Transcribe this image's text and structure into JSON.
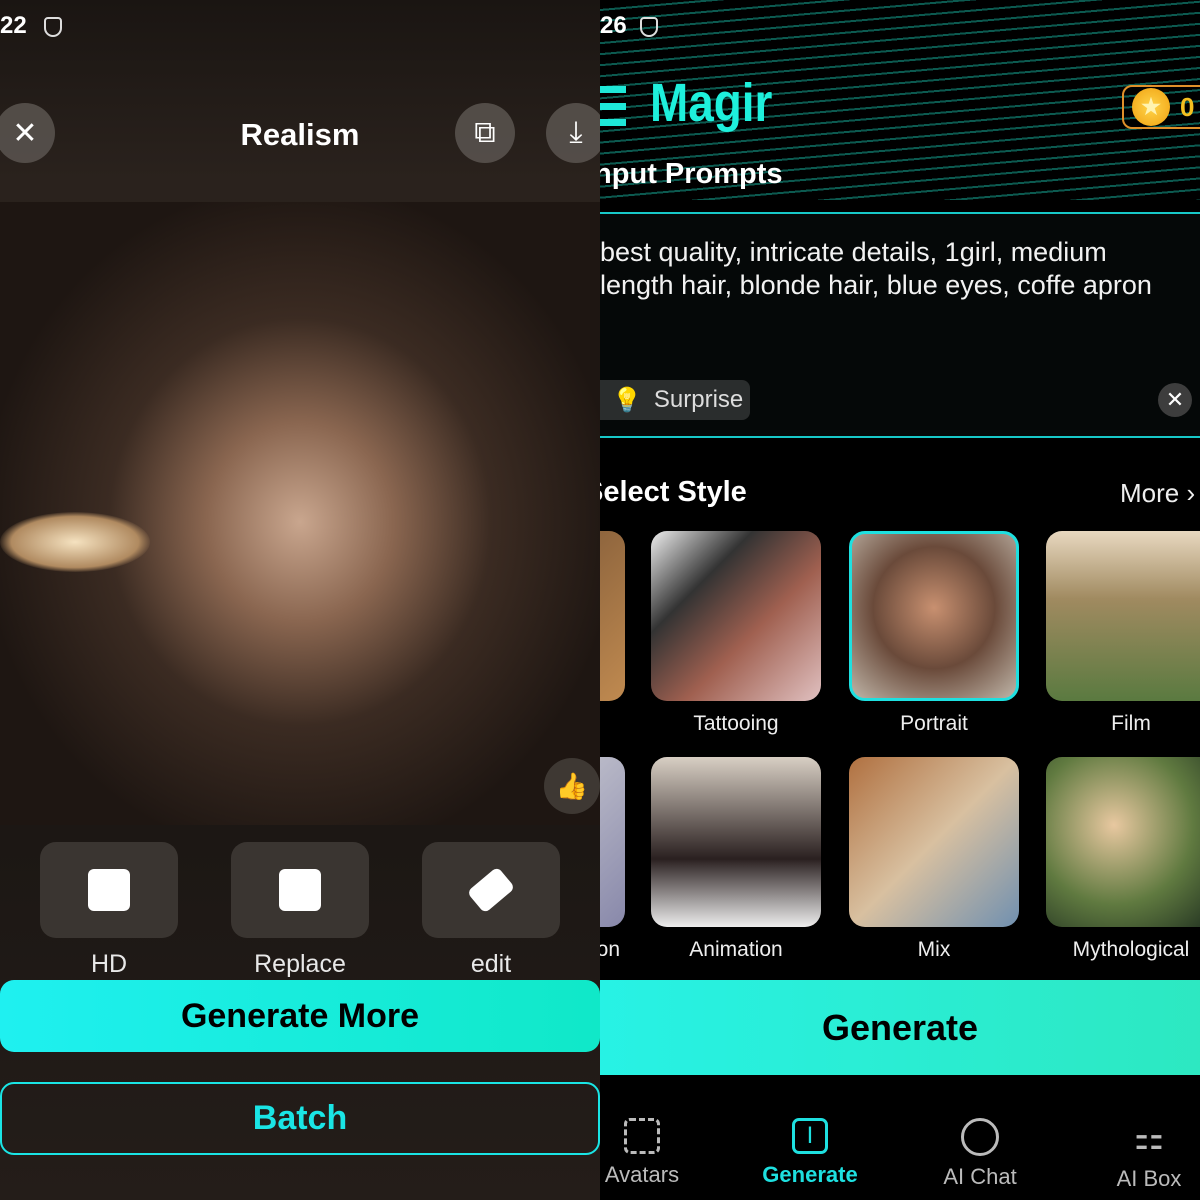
{
  "left": {
    "status_time": "22",
    "title": "Realism",
    "tools": [
      {
        "label": "HD",
        "icon": "expand-icon"
      },
      {
        "label": "Replace",
        "icon": "replace-image-icon"
      },
      {
        "label": "edit",
        "icon": "eraser-icon"
      }
    ],
    "generate_more": "Generate More",
    "batch": "Batch"
  },
  "right": {
    "status_time": "26",
    "app_name": "Magir",
    "coins": "0",
    "input_prompts_title": "Input Prompts",
    "prompt_text": "best quality, intricate details, 1girl,  medium length hair, blonde hair, blue eyes, coffe apron",
    "surprise": "Surprise",
    "select_style_title": "Select Style",
    "more": "More",
    "styles": [
      {
        "label": ""
      },
      {
        "label": "Tattooing"
      },
      {
        "label": "Portrait",
        "selected": true
      },
      {
        "label": "Film"
      },
      {
        "label": "on"
      },
      {
        "label": "Animation"
      },
      {
        "label": "Mix"
      },
      {
        "label": "Mythological"
      }
    ],
    "generate": "Generate",
    "nav": [
      {
        "label": "Avatars",
        "icon": "face-scan-icon"
      },
      {
        "label": "Generate",
        "icon": "text-cursor-icon",
        "active": true
      },
      {
        "label": "AI Chat",
        "icon": "chat-bubble-icon"
      },
      {
        "label": "AI Box",
        "icon": "grid-icon"
      }
    ],
    "accent": "#1ee8e0"
  }
}
